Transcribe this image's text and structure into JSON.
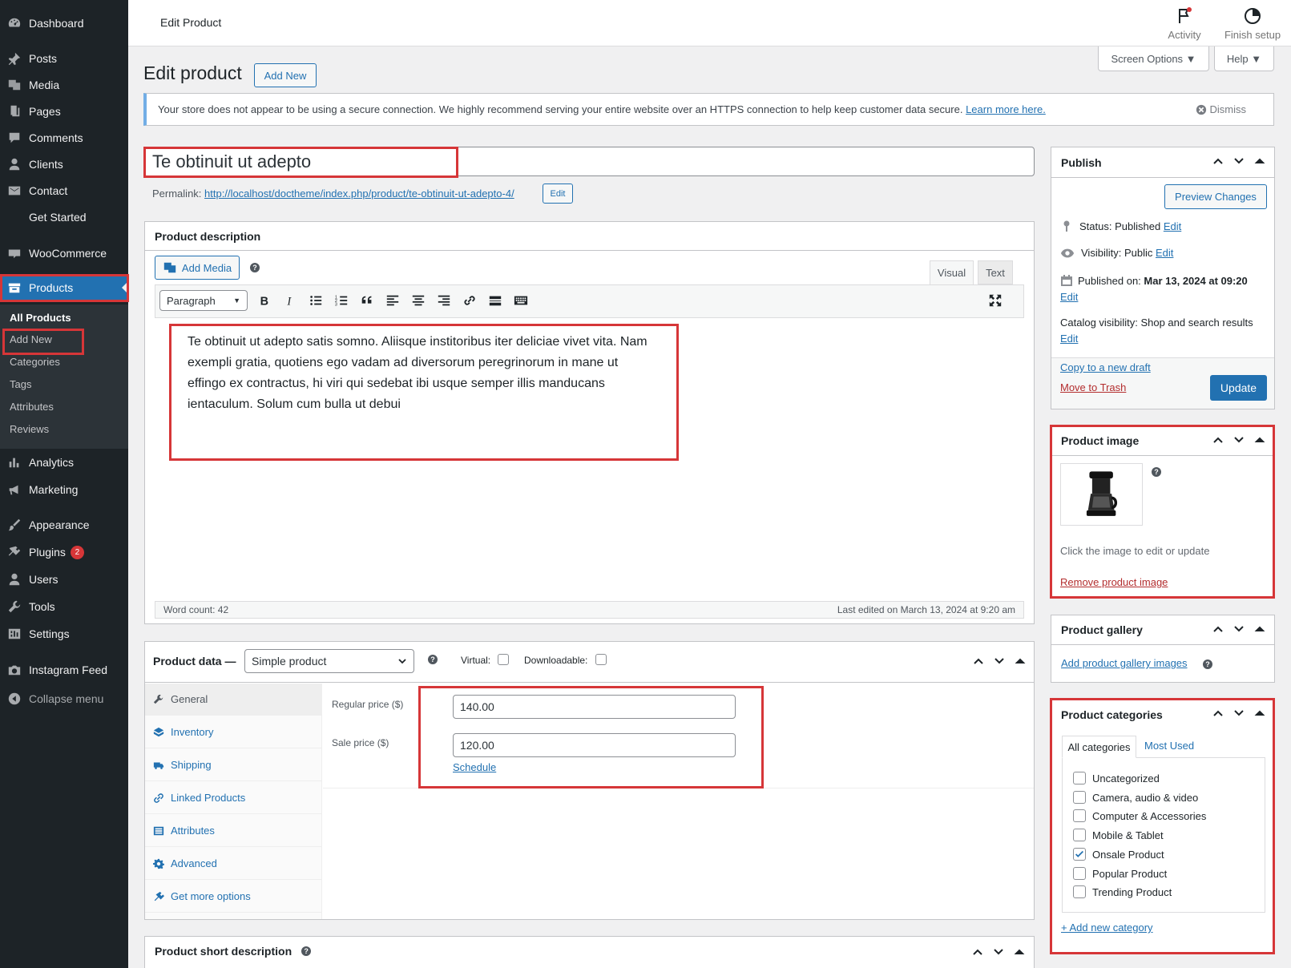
{
  "topbar": {
    "title": "Edit Product",
    "activity_label": "Activity",
    "finish_setup_label": "Finish setup",
    "screen_options_label": "Screen Options ▼",
    "help_label": "Help ▼"
  },
  "sidebar": {
    "items": [
      {
        "label": "Dashboard",
        "icon": "dashboard-icon"
      },
      {
        "label": "Posts",
        "icon": "pin-icon"
      },
      {
        "label": "Media",
        "icon": "media-icon"
      },
      {
        "label": "Pages",
        "icon": "pages-icon"
      },
      {
        "label": "Comments",
        "icon": "comment-icon"
      },
      {
        "label": "Clients",
        "icon": "user-icon"
      },
      {
        "label": "Contact",
        "icon": "mail-icon"
      },
      {
        "label": "Get Started",
        "icon": ""
      },
      {
        "label": "WooCommerce",
        "icon": "woo-icon"
      },
      {
        "label": "Products",
        "icon": "products-icon"
      },
      {
        "label": "Analytics",
        "icon": "chart-icon"
      },
      {
        "label": "Marketing",
        "icon": "megaphone-icon"
      },
      {
        "label": "Appearance",
        "icon": "brush-icon"
      },
      {
        "label": "Plugins",
        "icon": "plugin-icon",
        "badge": "2"
      },
      {
        "label": "Users",
        "icon": "user-icon"
      },
      {
        "label": "Tools",
        "icon": "wrench-icon"
      },
      {
        "label": "Settings",
        "icon": "settings-icon"
      },
      {
        "label": "Instagram Feed",
        "icon": "camera-icon"
      },
      {
        "label": "Collapse menu",
        "icon": "collapse-icon"
      }
    ],
    "submenu": [
      "All Products",
      "Add New",
      "Categories",
      "Tags",
      "Attributes",
      "Reviews"
    ]
  },
  "heading": {
    "title": "Edit product",
    "add_new": "Add New"
  },
  "notice": {
    "text": "Your store does not appear to be using a secure connection. We highly recommend serving your entire website over an HTTPS connection to help keep customer data secure.",
    "link": "Learn more here.",
    "dismiss": "Dismiss"
  },
  "product": {
    "title": "Te obtinuit ut adepto",
    "permalink_label": "Permalink:",
    "permalink_url": "http://localhost/doctheme/index.php/product/te-obtinuit-ut-adepto-4/",
    "permalink_edit": "Edit"
  },
  "description": {
    "heading": "Product description",
    "add_media": "Add Media",
    "tab_visual": "Visual",
    "tab_text": "Text",
    "format_select": "Paragraph",
    "body": "Te obtinuit ut adepto satis somno. Aliisque institoribus iter deliciae vivet vita. Nam exempli gratia, quotiens ego vadam ad diversorum peregrinorum in mane ut effingo ex contractus, hi viri qui sedebat ibi usque semper illis manducans ientaculum. Solum cum bulla ut debui",
    "word_count": "Word count: 42",
    "last_edited": "Last edited on March 13, 2024 at 9:20 am"
  },
  "product_data": {
    "heading": "Product data —",
    "type": "Simple product",
    "virtual_label": "Virtual:",
    "downloadable_label": "Downloadable:",
    "tabs": [
      "General",
      "Inventory",
      "Shipping",
      "Linked Products",
      "Attributes",
      "Advanced",
      "Get more options"
    ],
    "regular_price_label": "Regular price ($)",
    "regular_price": "140.00",
    "sale_price_label": "Sale price ($)",
    "sale_price": "120.00",
    "schedule": "Schedule"
  },
  "short_description": {
    "heading": "Product short description"
  },
  "publish": {
    "heading": "Publish",
    "preview": "Preview Changes",
    "status_label": "Status:",
    "status_value": "Published",
    "visibility_label": "Visibility:",
    "visibility_value": "Public",
    "published_label": "Published on:",
    "published_value": "Mar 13, 2024 at 09:20",
    "catalog_label": "Catalog visibility:",
    "catalog_value": "Shop and search results",
    "edit": "Edit",
    "copy_draft": "Copy to a new draft",
    "trash": "Move to Trash",
    "update": "Update"
  },
  "product_image": {
    "heading": "Product image",
    "hint": "Click the image to edit or update",
    "remove": "Remove product image"
  },
  "gallery": {
    "heading": "Product gallery",
    "add": "Add product gallery images"
  },
  "categories": {
    "heading": "Product categories",
    "tab_all": "All categories",
    "tab_used": "Most Used",
    "items": [
      {
        "label": "Uncategorized",
        "checked": false
      },
      {
        "label": "Camera, audio & video",
        "checked": false
      },
      {
        "label": "Computer & Accessories",
        "checked": false
      },
      {
        "label": "Mobile & Tablet",
        "checked": false
      },
      {
        "label": "Onsale Product",
        "checked": true
      },
      {
        "label": "Popular Product",
        "checked": false
      },
      {
        "label": "Trending Product",
        "checked": false
      }
    ],
    "add_new": "+ Add new category"
  },
  "colors": {
    "accent": "#2271b1",
    "sidebar": "#1d2327",
    "highlight": "#d63638"
  }
}
